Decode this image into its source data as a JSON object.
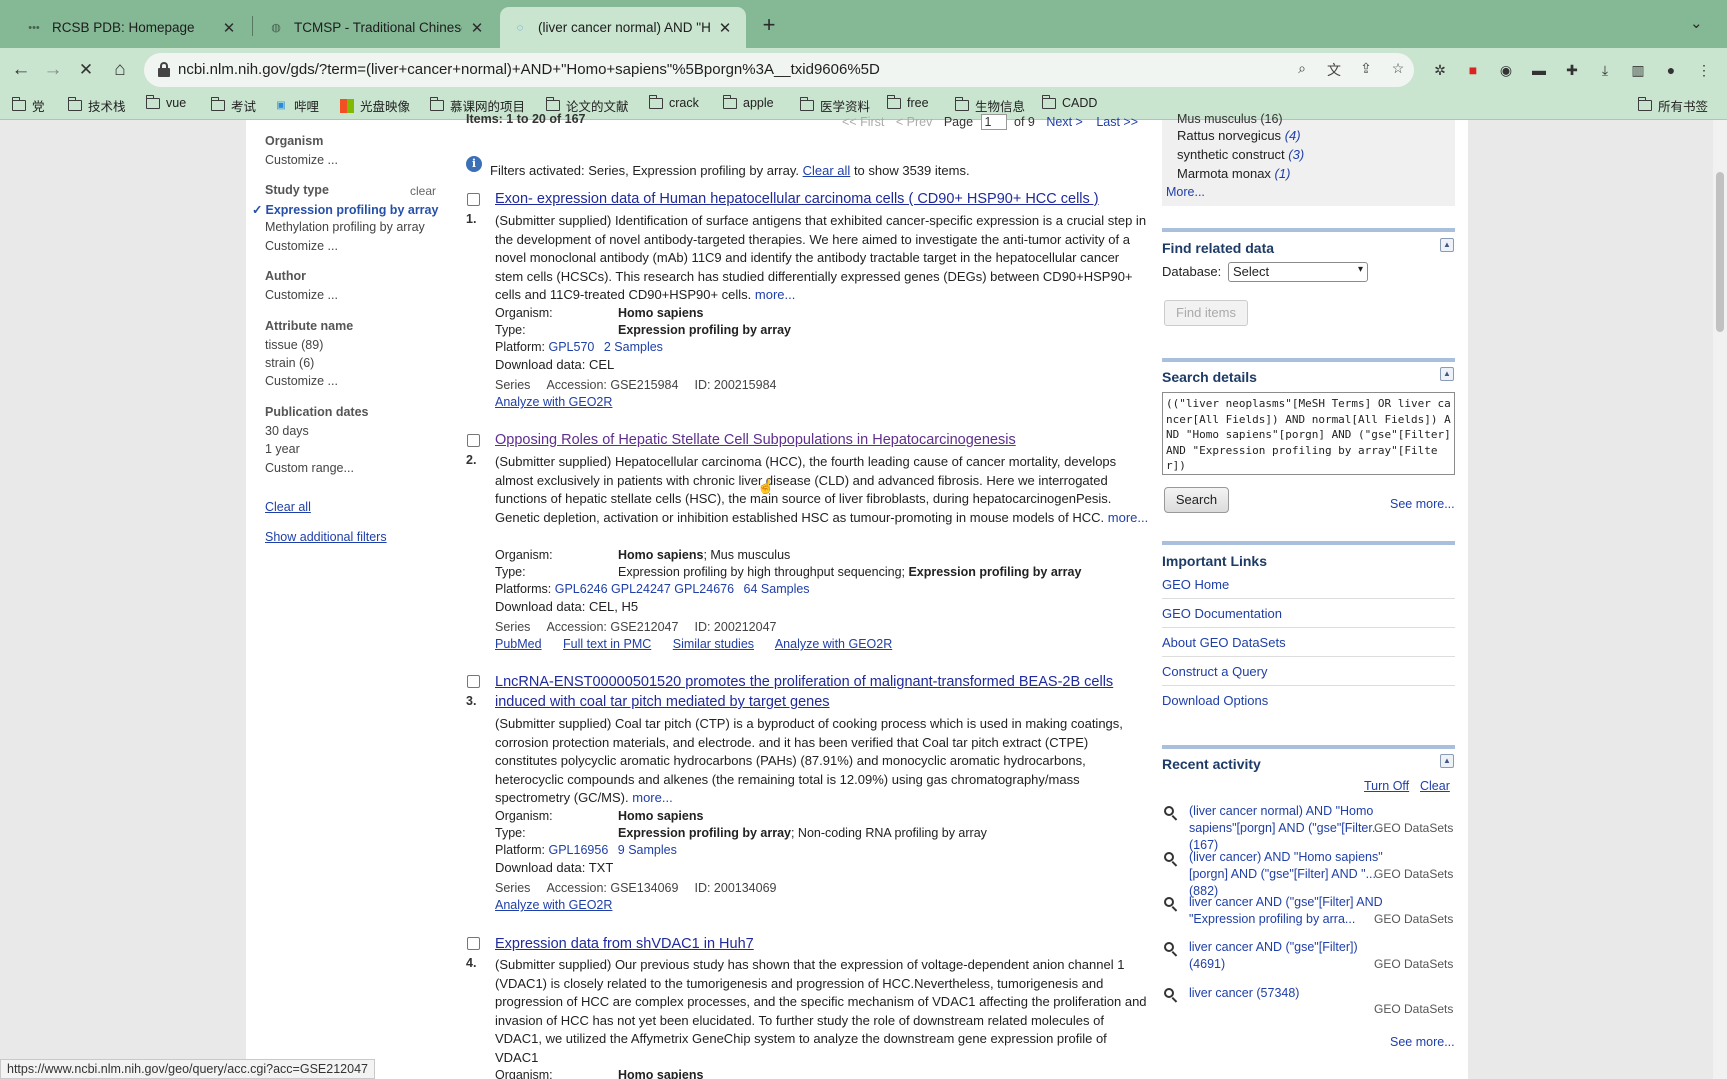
{
  "browser": {
    "tabs": [
      {
        "title": "RCSB PDB: Homepage",
        "active": false
      },
      {
        "title": "TCMSP - Traditional Chinese M",
        "active": false
      },
      {
        "title": "(liver cancer normal) AND \"Hor",
        "active": true
      }
    ],
    "new_tab": "+",
    "url": "ncbi.nlm.nih.gov/gds/?term=(liver+cancer+normal)+AND+\"Homo+sapiens\"%5Bporgn%3A__txid9606%5D",
    "bookmarks": [
      "党",
      "技术栈",
      "vue",
      "考试",
      "哔哩",
      "光盘映像",
      "慕课网的项目",
      "论文的文献",
      "crack",
      "apple",
      "医学资料",
      "free",
      "生物信息",
      "CADD"
    ],
    "all_bookmarks": "所有书签",
    "status_url": "https://www.ncbi.nlm.nih.gov/geo/query/acc.cgi?acc=GSE212047"
  },
  "pagination": {
    "items_label": "Items: 1 to 20 of 167",
    "first": "<< First",
    "prev": "< Prev",
    "page_label": "Page",
    "page_value": "1",
    "of_label": "of 9",
    "next": "Next >",
    "last": "Last >>"
  },
  "filters_notice": {
    "text": "Filters activated: Series, Expression profiling by array.",
    "clear_all": "Clear all",
    "suffix": "to show 3539 items."
  },
  "sidebar": {
    "organism": {
      "heading": "Organism",
      "customize": "Customize ..."
    },
    "study_type": {
      "heading": "Study type",
      "clear": "clear",
      "selected": "Expression profiling by array",
      "other": "Methylation profiling by array",
      "customize": "Customize ..."
    },
    "author": {
      "heading": "Author",
      "customize": "Customize ..."
    },
    "attribute": {
      "heading": "Attribute name",
      "items": [
        "tissue (89)",
        "strain (6)"
      ],
      "customize": "Customize ..."
    },
    "publication": {
      "heading": "Publication dates",
      "items": [
        "30 days",
        "1 year",
        "Custom range..."
      ]
    },
    "clear_all": "Clear all",
    "show_additional": "Show additional filters"
  },
  "results": [
    {
      "num": "1.",
      "title": "Exon- expression data of Human hepatocellular carcinoma cells ( CD90+ HSP90+ HCC cells )",
      "summary": "(Submitter supplied) Identification of surface antigens that exhibited cancer-specific expression is a crucial step in the development of novel antibody-targeted therapies. We here aimed to investigate the anti-tumor activity of a novel monoclonal antibody (mAb) 11C9 and identify the antibody tractable target in the hepatocellular cancer stem cells (HCSCs). This research has studied differentially expressed genes (DEGs) between CD90+HSP90+ cells and 11C9-treated CD90+HSP90+ cells.",
      "more": "more...",
      "organism_label": "Organism:",
      "organism": "Homo sapiens",
      "organism_extra": "",
      "type_label": "Type:",
      "type": "Expression profiling by array",
      "type_pre": "",
      "type_post": "",
      "platform_label": "Platform:",
      "platforms": "GPL570",
      "samples": "2 Samples",
      "download": "Download data: CEL",
      "series": "Series",
      "accession": "Accession: GSE215984",
      "id": "ID: 200215984",
      "links": [
        "Analyze with GEO2R"
      ]
    },
    {
      "num": "2.",
      "title": "Opposing Roles of Hepatic Stellate Cell Subpopulations in Hepatocarcinogenesis",
      "summary": "(Submitter supplied) Hepatocellular carcinoma (HCC), the fourth leading cause of cancer mortality, develops almost exclusively in patients with chronic liver disease (CLD) and advanced fibrosis. Here we interrogated functions of hepatic stellate cells (HSC), the main source of liver fibroblasts, during hepatocarcinogenPesis. Genetic depletion, activation or inhibition established HSC as tumour-promoting in mouse models of HCC.",
      "more": "more...",
      "organism_label": "Organism:",
      "organism": "Homo sapiens",
      "organism_extra": "; Mus musculus",
      "type_label": "Type:",
      "type": "Expression profiling by array",
      "type_pre": "Expression profiling by high throughput sequencing; ",
      "type_post": "",
      "platform_label": "Platforms:",
      "platforms": "GPL6246 GPL24247 GPL24676",
      "samples": "64 Samples",
      "download": "Download data: CEL, H5",
      "series": "Series",
      "accession": "Accession: GSE212047",
      "id": "ID: 200212047",
      "links": [
        "PubMed",
        "Full text in PMC",
        "Similar studies",
        "Analyze with GEO2R"
      ]
    },
    {
      "num": "3.",
      "title": "LncRNA-ENST00000501520 promotes the proliferation of malignant-transformed BEAS-2B cells",
      "title2": "induced with coal tar pitch mediated by target genes",
      "summary": "(Submitter supplied) Coal tar pitch (CTP) is a byproduct of cooking process which is used in making coatings, corrosion protection materials, and electrode. and it has been verified that Coal tar pitch extract (CTPE) constitutes polycyclic aromatic hydrocarbons (PAHs) (87.91%) and monocyclic aromatic hydrocarbons, heterocyclic compounds and alkenes (the remaining total is 12.09%) using gas chromatography/mass spectrometry (GC/MS).",
      "more": "more...",
      "organism_label": "Organism:",
      "organism": "Homo sapiens",
      "organism_extra": "",
      "type_label": "Type:",
      "type": "Expression profiling by array",
      "type_pre": "",
      "type_post": "; Non-coding RNA profiling by array",
      "platform_label": "Platform:",
      "platforms": "GPL16956",
      "samples": "9 Samples",
      "download": "Download data: TXT",
      "series": "Series",
      "accession": "Accession: GSE134069",
      "id": "ID: 200134069",
      "links": [
        "Analyze with GEO2R"
      ]
    },
    {
      "num": "4.",
      "title": "Expression data from shVDAC1 in Huh7",
      "summary": "(Submitter supplied) Our previous study has shown that the expression of voltage-dependent anion channel 1 (VDAC1) is closely related to the tumorigenesis and progression of HCC.Nevertheless, tumorigenesis and progression of HCC are complex processes, and the specific mechanism of VDAC1 affecting the proliferation and invasion of HCC has not yet been elucidated. To further study the role of downstream related molecules of VDAC1, we utilized the Affymetrix GeneChip system to analyze the downstream gene expression profile of VDAC1",
      "organism_label": "Organism:",
      "organism": "Homo sapiens"
    }
  ],
  "right": {
    "organism_list": [
      "Mus musculus (16)",
      "Rattus norvegicus",
      "(4)",
      "synthetic construct",
      "(3)",
      "Marmota monax",
      "(1)"
    ],
    "more": "More...",
    "find_related": {
      "title": "Find related data",
      "db_label": "Database:",
      "db_value": "Select",
      "button": "Find items"
    },
    "search_details": {
      "title": "Search details",
      "query": "((\"liver neoplasms\"[MeSH Terms] OR liver cancer[All Fields]) AND normal[All Fields]) AND \"Homo sapiens\"[porgn] AND (\"gse\"[Filter] AND \"Expression profiling by array\"[Filter])",
      "button": "Search",
      "see_more": "See more..."
    },
    "important_links": {
      "title": "Important Links",
      "items": [
        "GEO Home",
        "GEO Documentation",
        "About GEO DataSets",
        "Construct a Query",
        "Download Options"
      ]
    },
    "recent_activity": {
      "title": "Recent activity",
      "turn_off": "Turn Off",
      "clear": "Clear",
      "items": [
        {
          "text": "(liver cancer normal) AND \"Homo sapiens\"[porgn] AND (\"gse\"[Filter... (167)",
          "src": "GEO DataSets"
        },
        {
          "text": "(liver cancer) AND \"Homo sapiens\"[porgn] AND (\"gse\"[Filter] AND \"... (882)",
          "src": "GEO DataSets"
        },
        {
          "text": "liver cancer AND (\"gse\"[Filter] AND \"Expression profiling by arra...",
          "src": "GEO DataSets"
        },
        {
          "text": "liver cancer AND (\"gse\"[Filter]) (4691)",
          "src": "GEO DataSets"
        },
        {
          "text": "liver cancer (57348)",
          "src": "GEO DataSets"
        }
      ],
      "see_more": "See more..."
    }
  }
}
